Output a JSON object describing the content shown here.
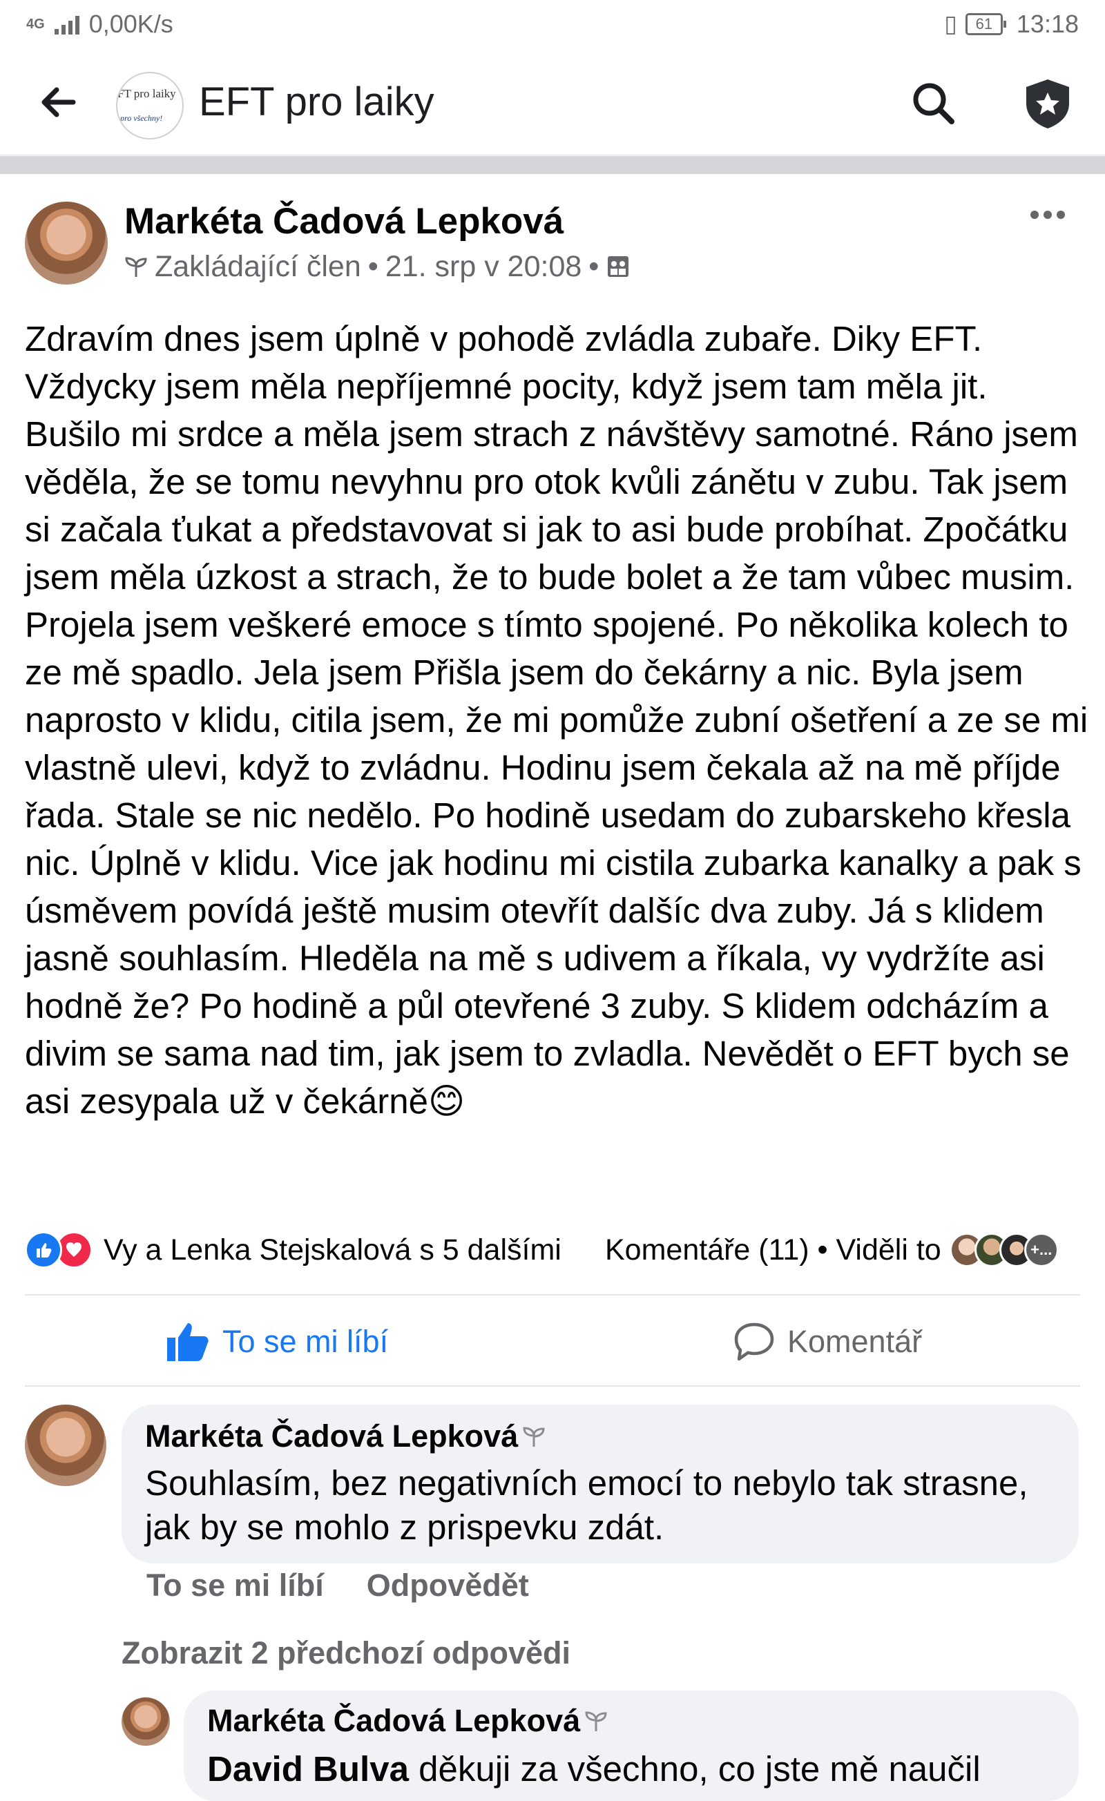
{
  "status_bar": {
    "network": "4G",
    "speed": "0,00K/s",
    "battery": "61",
    "time": "13:18"
  },
  "header": {
    "group_logo_line1": "FT pro laiky",
    "group_logo_line2": "pro všechny!",
    "title": "EFT pro laiky",
    "icons": [
      "back-arrow-icon",
      "search-icon",
      "shield-star-icon"
    ]
  },
  "post": {
    "author": "Markéta Čadová Lepková",
    "badge": "Zakládající člen",
    "date": "21. srp v 20:08",
    "text": "Zdravím dnes jsem úplně v pohodě zvládla zubaře. Diky EFT. Vždycky jsem měla nepříjemné pocity, když jsem tam měla jit. Bušilo mi srdce a měla jsem strach z návštěvy samotné. Ráno jsem věděla, že se tomu nevyhnu pro otok kvůli zánětu v zubu. Tak jsem si začala ťukat a představovat si jak to asi bude probíhat. Zpočátku jsem měla úzkost a strach, že to bude bolet a že tam vůbec musim. Projela jsem veškeré emoce s tímto spojené. Po několika kolech to ze mě spadlo. Jela jsem Přišla jsem do čekárny a nic. Byla jsem naprosto v klidu, citila jsem, že mi pomůže zubní ošetření a ze se mi vlastně ulevi, když to zvládnu. Hodinu jsem čekala až na mě příjde řada. Stale se nic nedělo. Po hodině usedam do zubarskeho křesla nic. Úplně v klidu. Vice jak hodinu mi cistila zubarka kanalky a pak s úsměvem povídá ještě musim otevřít dalšíc dva zuby. Já s klidem jasně souhlasím. Hleděla na mě s udivem a říkala, vy vydržíte asi hodně že? Po hodině a půl otevřené 3 zuby. S klidem odcházím a divim se sama nad tim, jak jsem to zvladla. Nevědět o EFT bych se asi zesypala už v čekárně😊",
    "reactions_text": "Vy a Lenka Stejskalová s 5 dalšími",
    "comments_seen": "Komentáře (11) • Viděli to",
    "seen_more": "+...",
    "like_label": "To se mi líbí",
    "comment_label": "Komentář"
  },
  "comments": [
    {
      "author": "Markéta Čadová Lepková",
      "text": "Souhlasím, bez negativních emocí to nebylo tak strasne, jak by se mohlo z prispevku zdát.",
      "like_action": "To se mi líbí",
      "reply_action": "Odpovědět"
    }
  ],
  "show_previous": "Zobrazit 2 předchozí odpovědi",
  "reply": {
    "author": "Markéta Čadová Lepková",
    "mention": "David Bulva",
    "text": "děkuji za všechno, co jste mě naučil"
  },
  "colors": {
    "accent": "#1877f2",
    "love": "#f02849",
    "muted": "#65676b",
    "bubble": "#f0f2f5"
  }
}
